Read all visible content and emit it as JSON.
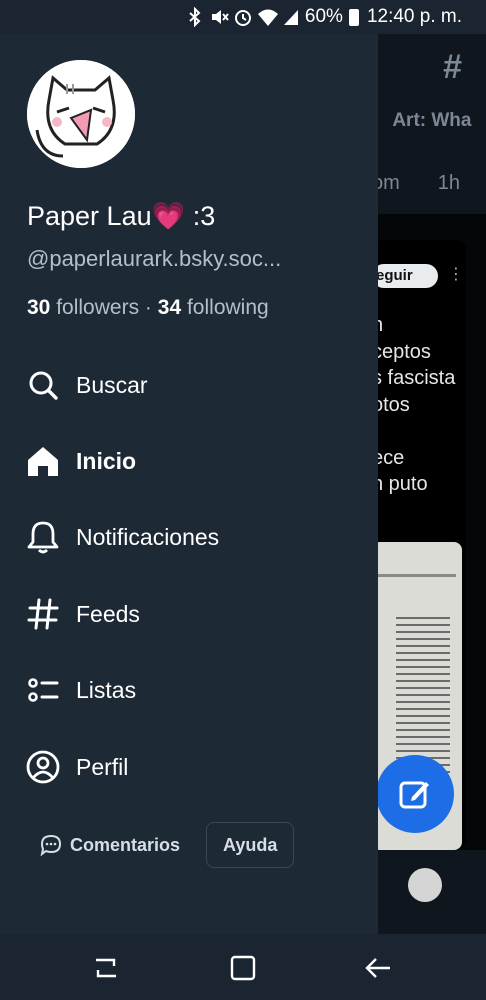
{
  "status_bar": {
    "battery": "60%",
    "time": "12:40 p. m.",
    "icons": [
      "bluetooth-icon",
      "mute-icon",
      "alarm-icon",
      "wifi-icon",
      "signal-icon",
      "battery-icon"
    ]
  },
  "background_feed": {
    "tab_partial_1": ")",
    "tab_partial_2": "Art: Wha",
    "meta_partial": "om",
    "time_partial": "1h",
    "follow_partial": "eguir",
    "post_text_partial": "n\nceptos\ns fascista\notos\n\nece\nn puto"
  },
  "profile": {
    "display_name": "Paper Lau💗 :3",
    "handle": "@paperlaurark.bsky.soc...",
    "followers_count": "30",
    "followers_label": "followers",
    "separator": "·",
    "following_count": "34",
    "following_label": "following"
  },
  "nav": [
    {
      "label": "Buscar",
      "icon": "search-icon"
    },
    {
      "label": "Inicio",
      "icon": "home-icon",
      "active": true
    },
    {
      "label": "Notificaciones",
      "icon": "bell-icon"
    },
    {
      "label": "Feeds",
      "icon": "hash-icon"
    },
    {
      "label": "Listas",
      "icon": "list-icon"
    },
    {
      "label": "Perfil",
      "icon": "user-circle-icon"
    }
  ],
  "footer": {
    "comments_label": "Comentarios",
    "help_label": "Ayuda"
  },
  "colors": {
    "drawer_bg": "#1e2936",
    "accent": "#1d6ee6",
    "muted_text": "#b5bfcb"
  }
}
